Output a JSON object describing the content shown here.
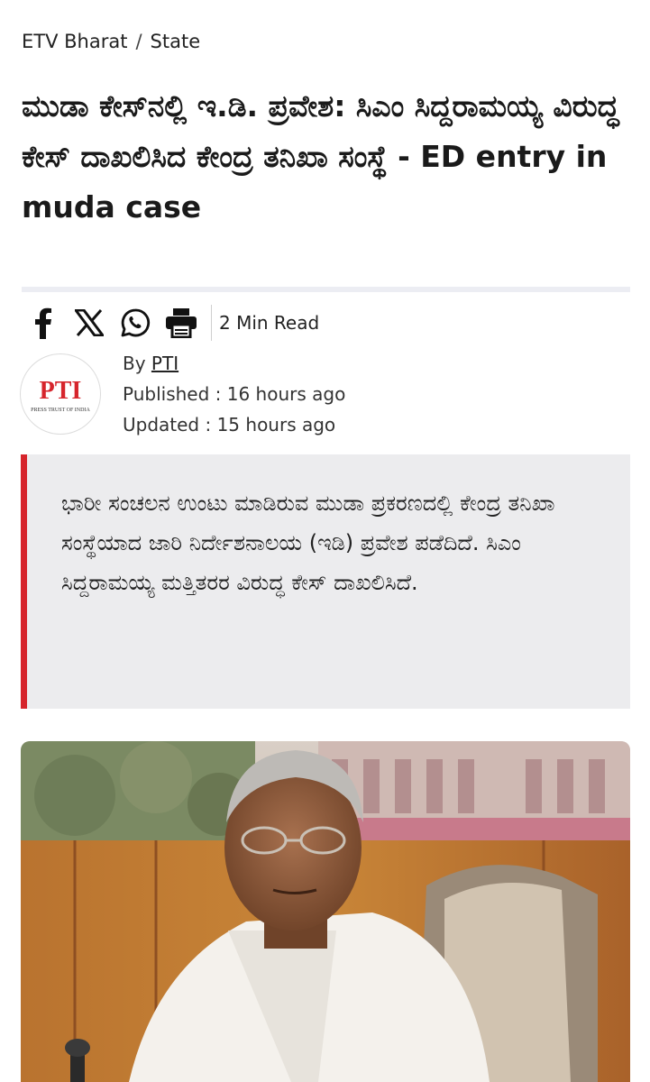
{
  "breadcrumb": {
    "site": "ETV Bharat",
    "separator": "/",
    "section": "State"
  },
  "article": {
    "title": "ಮುಡಾ ಕೇಸ್‌ನಲ್ಲಿ ಇ.ಡಿ. ಪ್ರವೇಶ: ಸಿಎಂ ಸಿದ್ದರಾಮಯ್ಯ ವಿರುದ್ಧ ಕೇಸ್ ದಾಖಲಿಸಿದ ಕೇಂದ್ರ ತನಿಖಾ ಸಂಸ್ಥೆ - ED entry in muda case",
    "read_time": "2 Min Read",
    "by_prefix": "By",
    "author": "PTI",
    "published": "Published : 16 hours ago",
    "updated": "Updated : 15 hours ago",
    "summary": "ಭಾರೀ ಸಂಚಲನ ಉಂಟು ಮಾಡಿರುವ ಮುಡಾ ಪ್ರಕರಣದಲ್ಲಿ ಕೇಂದ್ರ ತನಿಖಾ ಸಂಸ್ಥೆಯಾದ ಜಾರಿ ನಿರ್ದೇಶನಾಲಯ (ಇಡಿ) ಪ್ರವೇಶ ಪಡೆದಿದೆ. ಸಿಎಂ ಸಿದ್ದರಾಮಯ್ಯ ಮತ್ತಿತರರ ವಿರುದ್ಧ ಕೇಸ್ ದಾಖಲಿಸಿದೆ."
  },
  "share_icons": [
    "facebook-icon",
    "x-icon",
    "whatsapp-icon",
    "print-icon"
  ],
  "logo": {
    "mark": "PTI",
    "tagline": "PRESS TRUST OF INDIA"
  },
  "colors": {
    "accent": "#d6252c",
    "summary_bg": "#ececee",
    "divider": "#ecedf3"
  }
}
